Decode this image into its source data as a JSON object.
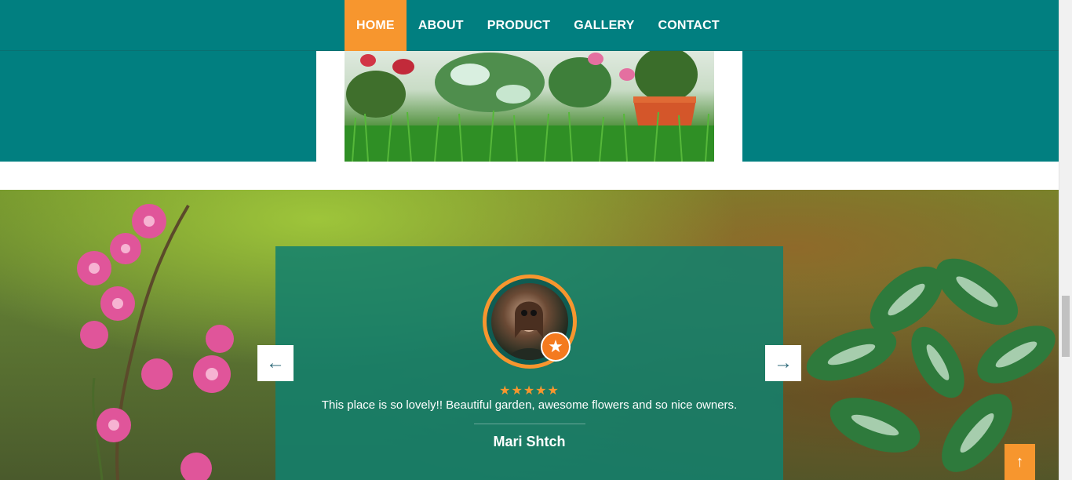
{
  "nav": {
    "items": [
      {
        "label": "HOME",
        "active": true
      },
      {
        "label": "ABOUT"
      },
      {
        "label": "PRODUCT"
      },
      {
        "label": "GALLERY"
      },
      {
        "label": "CONTACT"
      }
    ]
  },
  "testimonial": {
    "stars": "★★★★★",
    "rating": 5,
    "quote": "This place is so lovely!! Beautiful garden, awesome flowers and so nice owners.",
    "name": "Mari Shtch",
    "badge_icon": "star-icon"
  },
  "carousel": {
    "prev_icon": "arrow-left-icon",
    "prev_glyph": "←",
    "next_icon": "arrow-right-icon",
    "next_glyph": "→"
  },
  "back_to_top": {
    "icon": "arrow-up-icon",
    "glyph": "↑"
  },
  "colors": {
    "teal": "#017f80",
    "accent_orange": "#f7962e",
    "card": "#12806e"
  }
}
